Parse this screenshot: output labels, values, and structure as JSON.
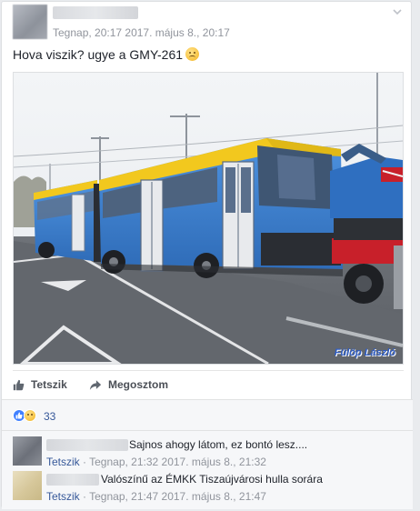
{
  "post": {
    "timestamp": "Tegnap, 20:17 2017. május 8., 20:17",
    "text": "Hova viszik? ugye a GMY-261",
    "photo_watermark": "Fülöp László"
  },
  "actions": {
    "like_label": "Tetszik",
    "share_label": "Megosztom"
  },
  "reactions": {
    "count": "33",
    "types": [
      "like",
      "sad"
    ]
  },
  "comments": [
    {
      "text": "Sajnos ahogy látom, ez bontó lesz....",
      "like_label": "Tetszik",
      "meta": " · Tegnap, 21:32 2017. május 8., 21:32"
    },
    {
      "text": "Valószínű az ÉMKK Tiszaújvárosi hulla sorára",
      "like_label": "Tetszik",
      "meta": " · Tegnap, 21:47 2017. május 8., 21:47"
    }
  ],
  "colors": {
    "link": "#365899",
    "meta": "#90949c",
    "bus_blue": "#3d7fd0",
    "bus_yellow": "#f2c81e",
    "truck_red": "#c8202a"
  },
  "icons": [
    "chevron-down-icon",
    "thumbs-up-icon",
    "share-arrow-icon",
    "like-reaction-icon",
    "sad-reaction-icon"
  ]
}
